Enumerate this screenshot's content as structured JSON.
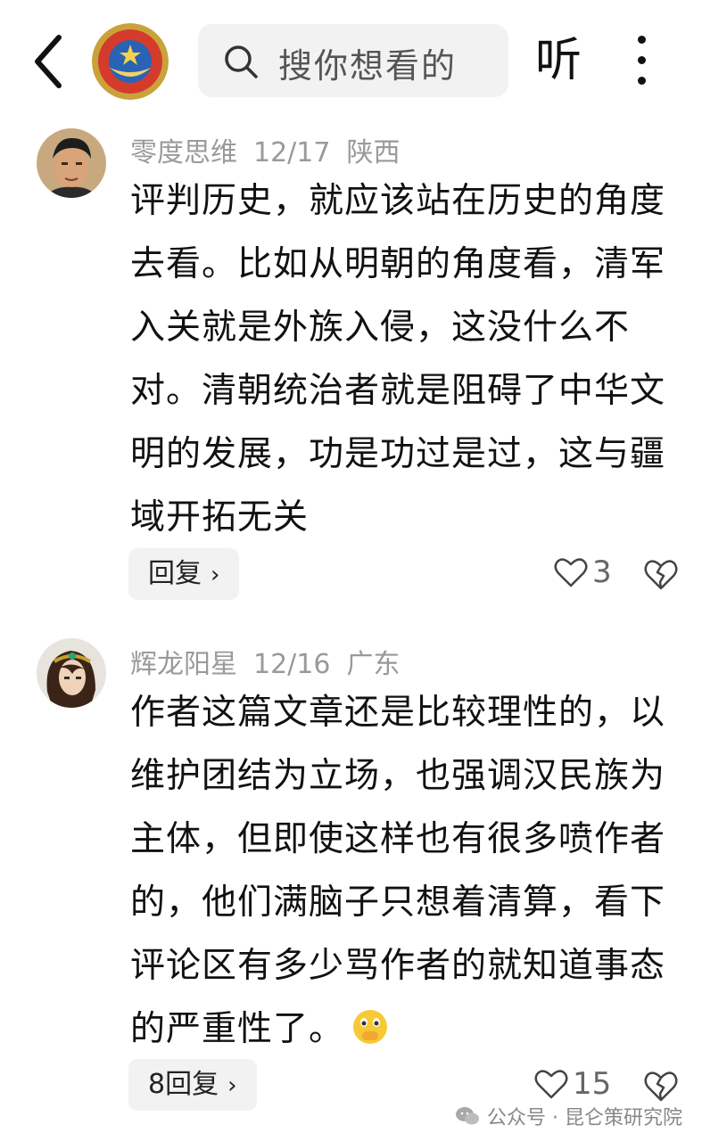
{
  "header": {
    "search_placeholder": "搜你想看的",
    "listen_label": "听"
  },
  "comments": [
    {
      "username": "零度思维",
      "date": "12/17",
      "location": "陕西",
      "text": "评判历史，就应该站在历史的角度去看。比如从明朝的角度看，清军入关就是外族入侵，这没什么不对。清朝统治者就是阻碍了中华文明的发展，功是功过是过，这与疆域开拓无关",
      "reply_label": "回复",
      "likes": "3"
    },
    {
      "username": "辉龙阳星",
      "date": "12/16",
      "location": "广东",
      "text": "作者这篇文章还是比较理性的，以维护团结为立场，也强调汉民族为主体，但即使这样也有很多喷作者的，他们满脑子只想着清算，看下评论区有多少骂作者的就知道事态的严重性了。",
      "reply_label": "8回复",
      "likes": "15",
      "emoji": "face-with-hand-over-mouth-emoji"
    }
  ],
  "watermark": {
    "text": "公众号 · 昆仑策研究院",
    "icon": "wechat-icon"
  },
  "colors": {
    "meta_gray": "#9a9a9a",
    "reply_bg": "#f2f2f2",
    "search_bg": "#f2f2f2"
  }
}
